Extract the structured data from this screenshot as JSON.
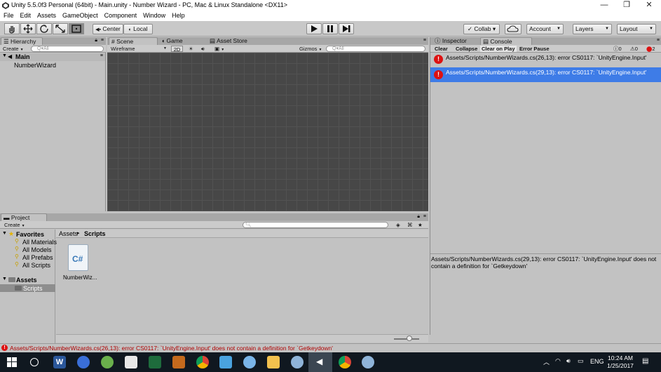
{
  "window": {
    "title": "Unity 5.5.0f3 Personal (64bit) - Main.unity - Number Wizard - PC, Mac & Linux Standalone <DX11>",
    "minimize": "—",
    "restore": "❐",
    "close": "✕"
  },
  "menu": [
    "File",
    "Edit",
    "Assets",
    "GameObject",
    "Component",
    "Window",
    "Help"
  ],
  "toolbar": {
    "pivot": "Center",
    "space": "Local",
    "collab": "Collab ▾",
    "account": "Account",
    "layers": "Layers",
    "layout": "Layout"
  },
  "hierarchy": {
    "tab": "Hierarchy",
    "create": "Create",
    "search_placeholder": "Q▾All",
    "scene": "Main",
    "items": [
      "NumberWizard"
    ]
  },
  "scene": {
    "tabs": [
      "Scene",
      "Game",
      "Asset Store"
    ],
    "shading": "Wireframe",
    "mode_2d": "2D",
    "gizmos": "Gizmos",
    "search_placeholder": "Q▾All"
  },
  "inspector": {
    "tabs": [
      "Inspector",
      "Console"
    ],
    "buttons": [
      "Clear",
      "Collapse",
      "Clear on Play",
      "Error Pause"
    ],
    "counts": {
      "info": "0",
      "warn": "0",
      "error": "2"
    },
    "logs": [
      {
        "text": "Assets/Scripts/NumberWizards.cs(26,13): error CS0117: `UnityEngine.Input'",
        "selected": false
      },
      {
        "text": "Assets/Scripts/NumberWizards.cs(29,13): error CS0117: `UnityEngine.Input'",
        "selected": true
      }
    ],
    "detail": "Assets/Scripts/NumberWizards.cs(29,13): error CS0117: `UnityEngine.Input' does not contain a definition for `Getkeydown'"
  },
  "project": {
    "tab": "Project",
    "create": "Create",
    "favorites_label": "Favorites",
    "favorites": [
      "All Materials",
      "All Models",
      "All Prefabs",
      "All Scripts"
    ],
    "assets_label": "Assets",
    "folders": [
      "Scripts"
    ],
    "breadcrumb": [
      "Assets",
      "Scripts"
    ],
    "files": [
      {
        "name": "NumberWiz...",
        "icon_text": "C#"
      }
    ]
  },
  "status": {
    "message": "Assets/Scripts/NumberWizards.cs(26,13): error CS0117: `UnityEngine.Input' does not contain a definition for `Getkeydown'"
  },
  "taskbar": {
    "language": "ENG",
    "time": "10:24 AM",
    "date": "1/25/2017"
  },
  "colors": {
    "selection": "#3e7ce7",
    "error": "#dd1111",
    "scene_bg": "#474747",
    "taskbar": "#101820"
  }
}
